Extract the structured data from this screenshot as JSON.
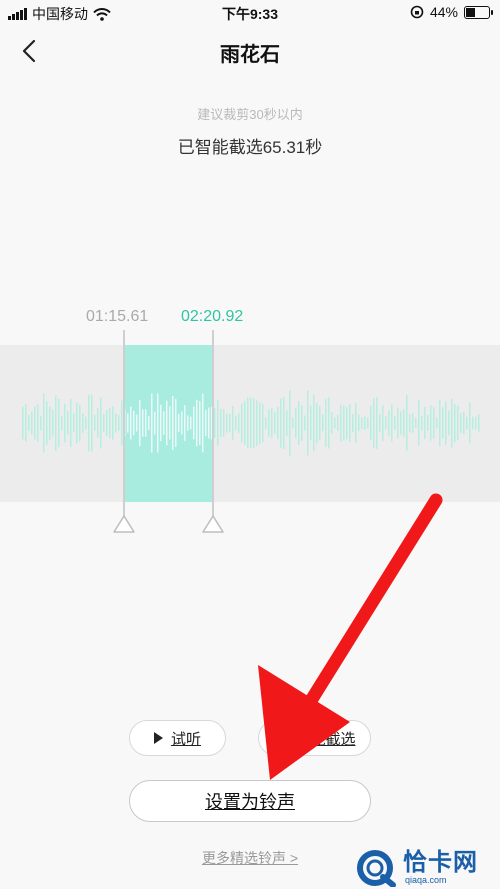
{
  "status_bar": {
    "carrier": "中国移动",
    "time": "下午9:33",
    "battery": "44%",
    "battery_level": 0.44
  },
  "header": {
    "title": "雨花石"
  },
  "hint": "建议裁剪30秒以内",
  "selected_text": "已智能截选65.31秒",
  "time_start": "01:15.61",
  "time_end": "02:20.92",
  "controls": {
    "preview_label": "试听",
    "smart_select_label": "智能截选"
  },
  "set_ringtone_label": "设置为铃声",
  "more_link": "更多精选铃声 >",
  "watermark": {
    "text": "恰卡网",
    "sub": "qiaqa.com"
  },
  "colors": {
    "accent": "#2fc4a3",
    "wave": "#b6eedf",
    "selection": "#a8ece0",
    "arrow": "#f01818"
  }
}
